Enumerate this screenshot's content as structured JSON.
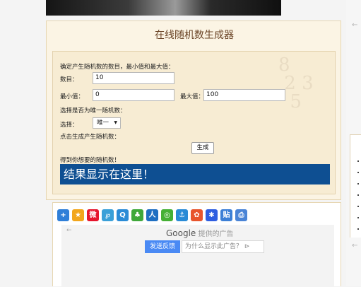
{
  "title": "在线随机数生成器",
  "instruction": "确定产生随机数的数目，最小值和最大值：",
  "count": {
    "label": "数目：",
    "value": "10"
  },
  "min": {
    "label": "最小值：",
    "value": "0"
  },
  "max": {
    "label": "最大值：",
    "value": "100"
  },
  "unique_question": "选择是否为唯一随机数：",
  "select": {
    "label": "选择：",
    "value": "唯一"
  },
  "click_hint": "点击生成产生随机数：",
  "generate_label": "生成",
  "got_label": "得到你想要的随机数！",
  "result_text": "结果显示在这里！",
  "share_icons": [
    {
      "name": "share-more-icon",
      "glyph": "+",
      "color": "#2f7fd8"
    },
    {
      "name": "qzone-icon",
      "glyph": "★",
      "color": "#f2a61c"
    },
    {
      "name": "weibo-icon",
      "glyph": "微",
      "color": "#e6162d"
    },
    {
      "name": "tencent-weibo-icon",
      "glyph": "℘",
      "color": "#3aa0d8"
    },
    {
      "name": "qq-icon",
      "glyph": "Q",
      "color": "#2a8bd6"
    },
    {
      "name": "kaixin-icon",
      "glyph": "♣",
      "color": "#3fa83a"
    },
    {
      "name": "renren-icon",
      "glyph": "人",
      "color": "#1f6fc2"
    },
    {
      "name": "wechat-icon",
      "glyph": "◎",
      "color": "#45b035"
    },
    {
      "name": "pengyou-icon",
      "glyph": "⚓",
      "color": "#2a8bd6"
    },
    {
      "name": "tieba-icon",
      "glyph": "✿",
      "color": "#e8552d"
    },
    {
      "name": "baidu-icon",
      "glyph": "✱",
      "color": "#2f5ee0"
    },
    {
      "name": "tieba-post-icon",
      "glyph": "贴",
      "color": "#3c7fd6"
    },
    {
      "name": "print-icon",
      "glyph": "⎙",
      "color": "#4a84d6"
    }
  ],
  "ad": {
    "brand": "Google",
    "suffix": " 提供的广告",
    "feedback": "发送反馈",
    "why": "为什么显示此广告？ ⊳"
  },
  "arrow_glyph": "←"
}
